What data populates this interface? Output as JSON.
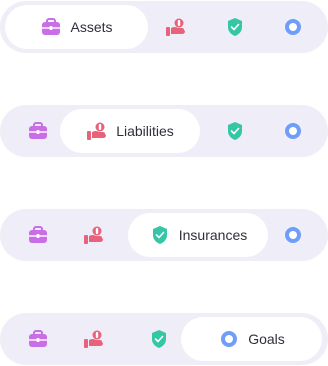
{
  "tabs": [
    {
      "label": "Assets",
      "icon": "briefcase-icon",
      "color": "#c86ee6"
    },
    {
      "label": "Liabilities",
      "icon": "hand-money-icon",
      "color": "#e7637c"
    },
    {
      "label": "Insurances",
      "icon": "shield-check-icon",
      "color": "#35c7a5"
    },
    {
      "label": "Goals",
      "icon": "target-ring-icon",
      "color": "#6f9dfa"
    }
  ],
  "states": [
    {
      "active": "Assets"
    },
    {
      "active": "Liabilities"
    },
    {
      "active": "Insurances"
    },
    {
      "active": "Goals"
    }
  ],
  "colors": {
    "bar_bg": "#efedf7",
    "pill_bg": "#ffffff",
    "text": "#2f2f3a"
  }
}
